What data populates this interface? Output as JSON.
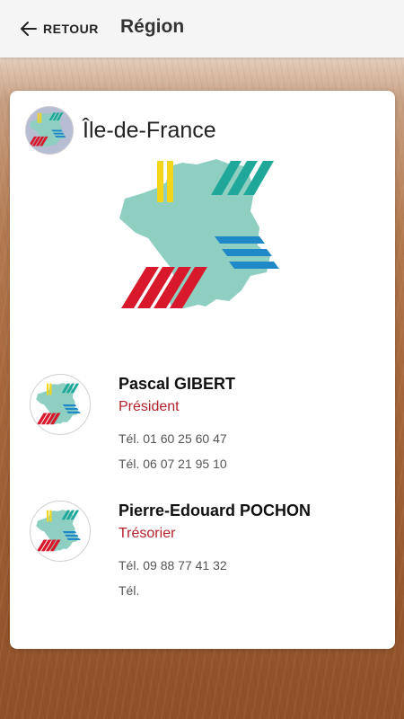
{
  "topbar": {
    "back_label": "RETOUR",
    "title": "Région"
  },
  "region": {
    "name": "Île-de-France"
  },
  "members": [
    {
      "name": "Pascal GIBERT",
      "role": "Président",
      "phone1": "Tél. 01 60 25 60 47",
      "phone2": "Tél. 06 07 21 95 10"
    },
    {
      "name": "Pierre-Edouard POCHON",
      "role": "Trésorier",
      "phone1": "Tél. 09 88 77 41 32",
      "phone2": "Tél."
    }
  ],
  "colors": {
    "map_fill": "#8ecfc2",
    "stripe_yellow": "#f3d51c",
    "stripe_teal": "#1fa89a",
    "stripe_blue": "#1e88c9",
    "stripe_red": "#d7192b",
    "role_red": "#b3202a"
  },
  "icons": {
    "back": "arrow-left-icon",
    "logo": "france-map-logo"
  }
}
